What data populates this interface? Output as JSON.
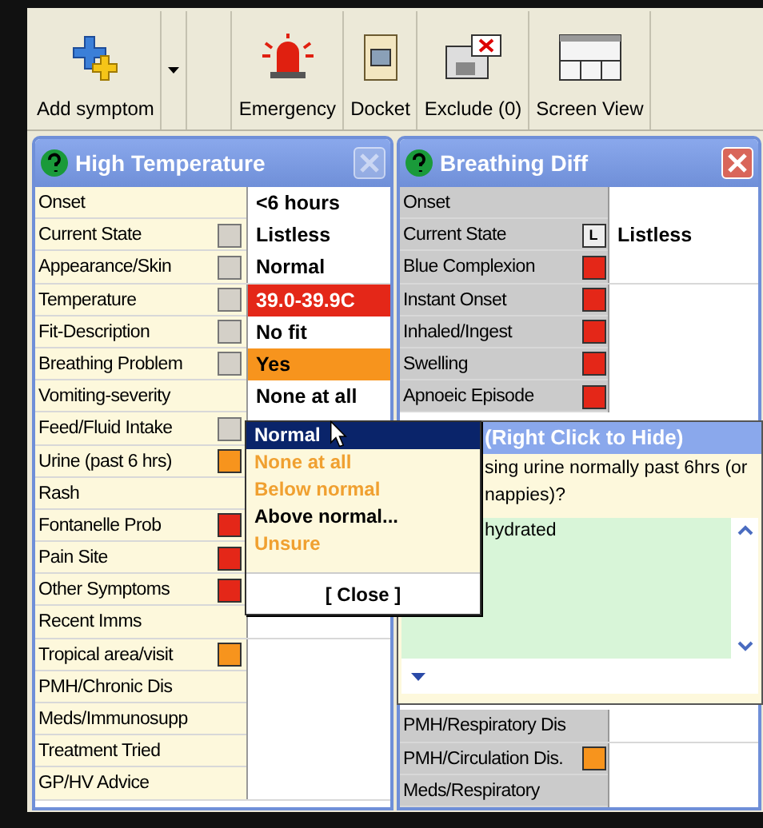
{
  "toolbar": [
    {
      "label": "Add symptom",
      "has_menu": true
    },
    {
      "label": "Emergency",
      "has_menu": false
    },
    {
      "label": "Docket",
      "has_menu": false
    },
    {
      "label": "Exclude (0)",
      "has_menu": false
    },
    {
      "label": "Screen View",
      "has_menu": false
    }
  ],
  "panels": [
    {
      "title": "High Temperature",
      "active": false,
      "rows": [
        {
          "label": "Onset",
          "kind": "plain",
          "value": "<6 hours"
        },
        {
          "label": "Current State",
          "kind": "check",
          "checked": false,
          "value": "Listless"
        },
        {
          "label": "Appearance/Skin",
          "kind": "check",
          "checked": false,
          "value": "Normal"
        },
        {
          "label": "Temperature",
          "kind": "check",
          "checked": false,
          "value": "39.0-39.9C",
          "color": "#e42718"
        },
        {
          "label": "Fit-Description",
          "kind": "check",
          "checked": false,
          "value": "No fit"
        },
        {
          "label": "Breathing Problem",
          "kind": "check",
          "checked": false,
          "value": "Yes",
          "color": "#f7941d"
        },
        {
          "label": "Vomiting-severity",
          "kind": "plain",
          "value": "None at all"
        },
        {
          "label": "Feed/Fluid Intake",
          "kind": "check",
          "checked": false
        },
        {
          "label": "Urine (past 6 hrs)",
          "kind": "flag",
          "color": "#f7941d"
        },
        {
          "label": "Rash",
          "kind": "plain"
        },
        {
          "label": "Fontanelle Prob",
          "kind": "flag",
          "color": "#e42718"
        },
        {
          "label": "Pain Site",
          "kind": "flag",
          "color": "#e42718"
        },
        {
          "label": "Other Symptoms",
          "kind": "flag",
          "color": "#e42718"
        },
        {
          "label": "Recent Imms",
          "kind": "plain"
        },
        {
          "label": "Tropical area/visit",
          "kind": "flag",
          "color": "#f7941d"
        },
        {
          "label": "PMH/Chronic Dis",
          "kind": "plain"
        },
        {
          "label": "Meds/Immunosupp",
          "kind": "plain"
        },
        {
          "label": "Treatment Tried",
          "kind": "plain"
        },
        {
          "label": "GP/HV Advice",
          "kind": "plain"
        }
      ]
    },
    {
      "title": "Breathing Diff",
      "active": true,
      "rows": [
        {
          "label": "Onset",
          "kind": "plain"
        },
        {
          "label": "Current State",
          "kind": "letter",
          "letter": "L",
          "value": "Listless"
        },
        {
          "label": "Blue Complexion",
          "kind": "flag",
          "color": "#e42718"
        },
        {
          "label": "Instant Onset",
          "kind": "flag",
          "color": "#e42718"
        },
        {
          "label": "Inhaled/Ingest",
          "kind": "flag",
          "color": "#e42718"
        },
        {
          "label": "Swelling",
          "kind": "flag",
          "color": "#e42718"
        },
        {
          "label": "Apnoeic Episode",
          "kind": "flag",
          "color": "#e42718"
        }
      ],
      "lower_rows": [
        {
          "label": "PMH/Respiratory Dis",
          "kind": "plain"
        },
        {
          "label": "PMH/Circulation Dis.",
          "kind": "flag",
          "color": "#f7941d"
        },
        {
          "label": "Meds/Respiratory",
          "kind": "plain"
        }
      ]
    }
  ],
  "tooltip": {
    "header": "(Right Click to Hide)",
    "question_lines": [
      "sing urine normally past 6hrs (or",
      "nappies)?"
    ],
    "answer": "hydrated"
  },
  "menu": {
    "options": [
      {
        "label": "Normal",
        "selected": true,
        "dimmed": false
      },
      {
        "label": "None at all",
        "selected": false,
        "dimmed": true
      },
      {
        "label": "Below normal",
        "selected": false,
        "dimmed": true
      },
      {
        "label": "Above normal...",
        "selected": false,
        "dimmed": false
      },
      {
        "label": "Unsure",
        "selected": false,
        "dimmed": true
      }
    ],
    "close": "[ Close ]"
  }
}
